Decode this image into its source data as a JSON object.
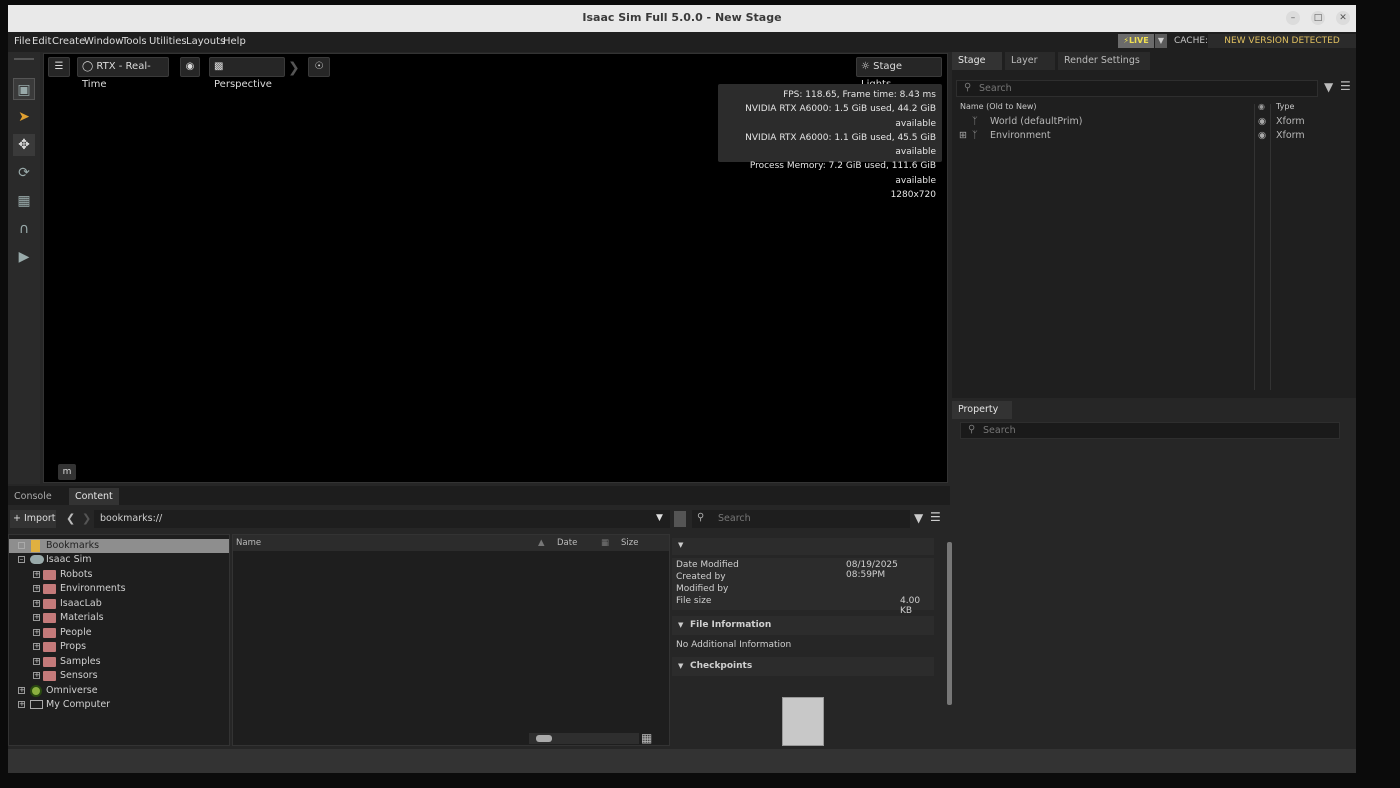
{
  "window": {
    "title": "Isaac Sim Full 5.0.0 - New Stage",
    "controls": [
      "minimize",
      "maximize",
      "close"
    ]
  },
  "menubar": {
    "items": [
      "File",
      "Edit",
      "Create",
      "Window",
      "Tools",
      "Utilities",
      "Layouts",
      "Help"
    ],
    "live_label": "LIVE",
    "cache_label": "CACHE:",
    "cache_status": "NEW VERSION DETECTED"
  },
  "viewport": {
    "render_mode": "RTX - Real-Time",
    "camera": "Perspective",
    "stage_lights": "Stage Lights",
    "stats": [
      "FPS: 118.65, Frame time: 8.43 ms",
      "NVIDIA RTX A6000: 1.5 GiB used, 44.2 GiB available",
      "NVIDIA RTX A6000: 1.1 GiB used, 45.5 GiB available",
      "Process Memory: 7.2 GiB used, 111.6 GiB available",
      "1280x720"
    ],
    "key_hint": "m"
  },
  "bottom_tabs": {
    "console": "Console",
    "content": "Content"
  },
  "content": {
    "import_label": "Import",
    "path": "bookmarks://",
    "search_placeholder": "Search",
    "tree": [
      {
        "label": "Bookmarks",
        "level": 0
      },
      {
        "label": "Isaac Sim",
        "level": 0
      },
      {
        "label": "Robots",
        "level": 1
      },
      {
        "label": "Environments",
        "level": 1
      },
      {
        "label": "IsaacLab",
        "level": 1
      },
      {
        "label": "Materials",
        "level": 1
      },
      {
        "label": "People",
        "level": 1
      },
      {
        "label": "Props",
        "level": 1
      },
      {
        "label": "Samples",
        "level": 1
      },
      {
        "label": "Sensors",
        "level": 1
      },
      {
        "label": "Omniverse",
        "level": 0
      },
      {
        "label": "My Computer",
        "level": 0
      }
    ],
    "columns": {
      "name": "Name",
      "date": "Date",
      "size": "Size"
    },
    "details": {
      "date_modified_label": "Date Modified",
      "date_modified_value": "08/19/2025 08:59PM",
      "created_by_label": "Created by",
      "modified_by_label": "Modified by",
      "file_size_label": "File size",
      "file_size_value": "4.00 KB",
      "file_info_title": "File Information",
      "file_info_text": "No Additional Information",
      "checkpoints_title": "Checkpoints"
    }
  },
  "stage": {
    "tabs": [
      "Stage",
      "Layer",
      "Render Settings"
    ],
    "search_placeholder": "Search",
    "col_name": "Name (Old to New)",
    "col_type": "Type",
    "rows": [
      {
        "name": "World (defaultPrim)",
        "type": "Xform"
      },
      {
        "name": "Environment",
        "type": "Xform"
      }
    ]
  },
  "property": {
    "tab": "Property",
    "search_placeholder": "Search"
  }
}
